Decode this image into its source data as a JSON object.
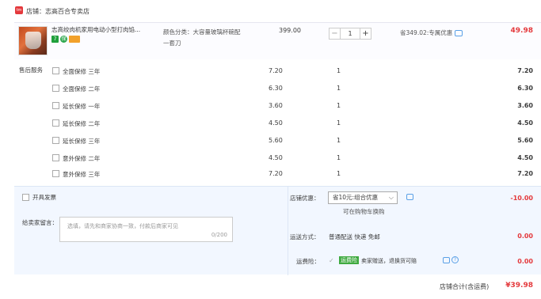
{
  "store": {
    "logo": "tmall",
    "label": "店铺：志高百合专卖店"
  },
  "item": {
    "title": "志高绞肉机家用电动小型打肉馅...",
    "badges": [
      "7",
      "保",
      "card"
    ],
    "spec": "颜色分类：大容量玻璃杯碗配一套刀",
    "price": "399.00",
    "qty_minus": "−",
    "qty": "1",
    "qty_plus": "+",
    "promo": "省349.02:专属优惠",
    "total": "49.98"
  },
  "warranty": {
    "label": "售后服务",
    "rows": [
      {
        "name": "全面保修 三年",
        "price": "7.20",
        "qty": "1",
        "total": "7.20"
      },
      {
        "name": "全面保修 二年",
        "price": "6.30",
        "qty": "1",
        "total": "6.30"
      },
      {
        "name": "延长保修 一年",
        "price": "3.60",
        "qty": "1",
        "total": "3.60"
      },
      {
        "name": "延长保修 二年",
        "price": "4.50",
        "qty": "1",
        "total": "4.50"
      },
      {
        "name": "延长保修 三年",
        "price": "5.60",
        "qty": "1",
        "total": "5.60"
      },
      {
        "name": "意外保修 二年",
        "price": "4.50",
        "qty": "1",
        "total": "4.50"
      },
      {
        "name": "意外保修 三年",
        "price": "7.20",
        "qty": "1",
        "total": "7.20"
      }
    ]
  },
  "bottom": {
    "invoice": "开具发票",
    "msg_label": "给卖家留言：",
    "msg_placeholder": "选填，请先和商家协商一致，付款后商家可见",
    "msg_count": "0/200",
    "discount_label": "店铺优惠：",
    "discount_select": "省10元:组合优惠",
    "discount_select_caret": "⌵",
    "discount_sub": "可在购物车换购",
    "discount_value": "-10.00",
    "ship_label": "运送方式：",
    "ship_value": "普通配送 快递 免邮",
    "ship_price": "0.00",
    "ins_label": "运费险：",
    "ins_check": "✓",
    "ins_badge": "运费险",
    "ins_text": "卖家赠送，退换货可赔",
    "ins_help": "?",
    "ins_price": "0.00"
  },
  "summary": {
    "label": "店铺合计(含运费)",
    "value": "¥39.98"
  },
  "colors": {
    "accent": "#e4393c",
    "panel": "#f2f7ff",
    "link": "#5aa0e6"
  }
}
